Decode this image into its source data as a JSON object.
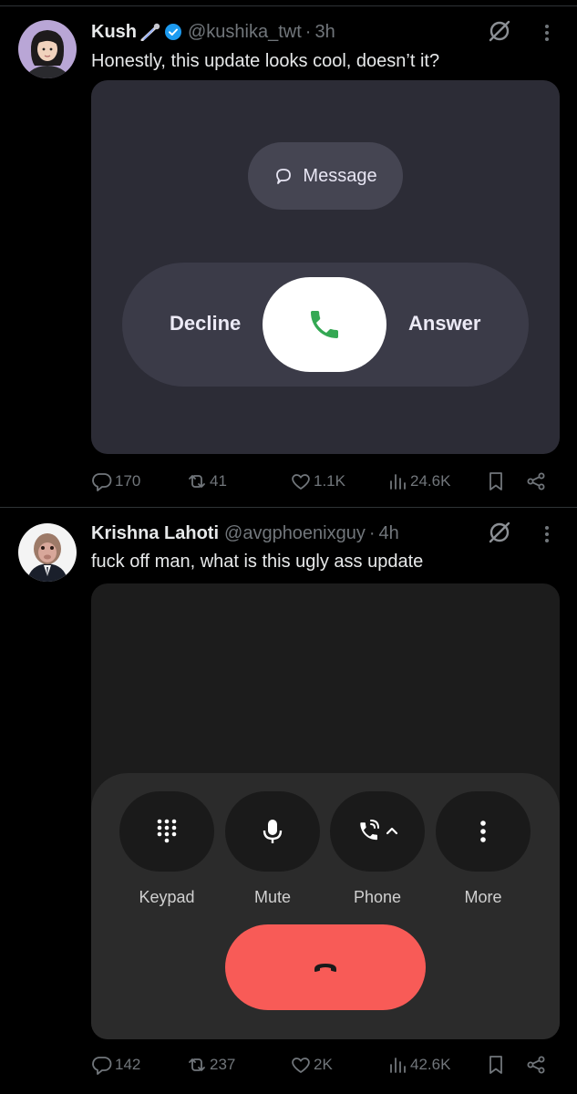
{
  "tweets": [
    {
      "name": "Kush",
      "handle": "@kushika_twt",
      "separator": "·",
      "time": "3h",
      "text": "Honestly, this update looks cool, doesn’t it?",
      "verified": true,
      "media": {
        "message_label": "Message",
        "decline_label": "Decline",
        "answer_label": "Answer"
      },
      "stats": {
        "replies": "170",
        "retweets": "41",
        "likes": "1.1K",
        "views": "24.6K"
      }
    },
    {
      "name": "Krishna Lahoti",
      "handle": "@avgphoenixguy",
      "separator": "·",
      "time": "4h",
      "text": "fuck off man, what is this ugly ass update",
      "verified": false,
      "media": {
        "keypad_label": "Keypad",
        "mute_label": "Mute",
        "phone_label": "Phone",
        "more_label": "More"
      },
      "stats": {
        "replies": "142",
        "retweets": "237",
        "likes": "2K",
        "views": "42.6K"
      }
    }
  ],
  "colors": {
    "background": "#000000",
    "text_primary": "#e7e9ea",
    "text_secondary": "#71767b",
    "verified_blue": "#1d9bf0",
    "answer_green": "#34a853",
    "end_call_red": "#f85b57"
  }
}
